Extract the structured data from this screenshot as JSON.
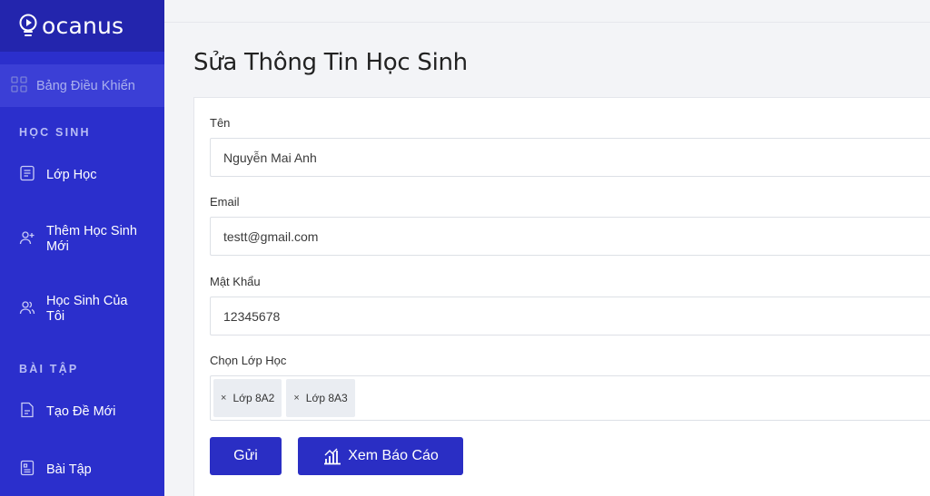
{
  "brand": {
    "name": "ocanus"
  },
  "sidebar": {
    "dashboard_label": "Bảng Điều Khiển",
    "sections": [
      {
        "title": "HỌC SINH"
      },
      {
        "title": "BÀI TẬP"
      }
    ],
    "items": [
      {
        "label": "Lớp Học",
        "icon": "list-icon"
      },
      {
        "label": "Thêm Học Sinh Mới",
        "icon": "user-add-icon"
      },
      {
        "label": "Học Sinh Của Tôi",
        "icon": "users-icon"
      },
      {
        "label": "Tạo Đề Mới",
        "icon": "file-edit-icon"
      },
      {
        "label": "Bài Tập",
        "icon": "file-list-icon"
      }
    ]
  },
  "page": {
    "title": "Sửa Thông Tin Học Sinh"
  },
  "form": {
    "name": {
      "label": "Tên",
      "value": "Nguyễn Mai Anh"
    },
    "email": {
      "label": "Email",
      "value": "testt@gmail.com"
    },
    "password": {
      "label": "Mật Khẩu",
      "value": "12345678"
    },
    "classes": {
      "label": "Chọn Lớp Học",
      "selected": [
        "Lớp 8A2",
        "Lớp 8A3"
      ]
    },
    "submit_label": "Gửi",
    "report_label": "Xem Báo Cáo"
  },
  "colors": {
    "sidebar": "#2b2fcc",
    "logo_bar": "#2325ad",
    "button": "#2a2ec4"
  }
}
